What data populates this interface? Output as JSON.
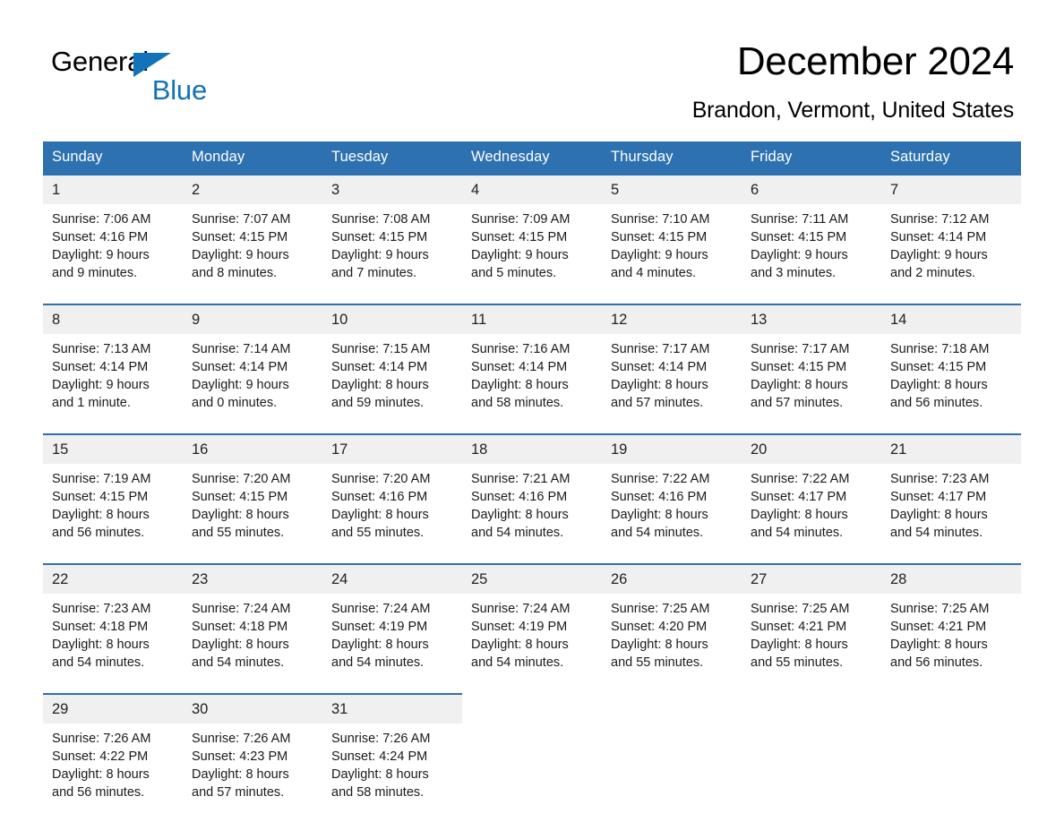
{
  "brand": {
    "word_general": "General",
    "word_blue": "Blue",
    "triangle_color": "#1272BA"
  },
  "header": {
    "month_title": "December 2024",
    "location": "Brandon, Vermont, United States"
  },
  "theme": {
    "header_blue": "#2E71B0",
    "date_band_gray": "#F0F0F0",
    "text_color": "#1a1a1a"
  },
  "weekday_headers": [
    "Sunday",
    "Monday",
    "Tuesday",
    "Wednesday",
    "Thursday",
    "Friday",
    "Saturday"
  ],
  "weeks": [
    [
      {
        "day": "1",
        "sunrise": "Sunrise: 7:06 AM",
        "sunset": "Sunset: 4:16 PM",
        "daylight_line1": "Daylight: 9 hours",
        "daylight_line2": "and 9 minutes."
      },
      {
        "day": "2",
        "sunrise": "Sunrise: 7:07 AM",
        "sunset": "Sunset: 4:15 PM",
        "daylight_line1": "Daylight: 9 hours",
        "daylight_line2": "and 8 minutes."
      },
      {
        "day": "3",
        "sunrise": "Sunrise: 7:08 AM",
        "sunset": "Sunset: 4:15 PM",
        "daylight_line1": "Daylight: 9 hours",
        "daylight_line2": "and 7 minutes."
      },
      {
        "day": "4",
        "sunrise": "Sunrise: 7:09 AM",
        "sunset": "Sunset: 4:15 PM",
        "daylight_line1": "Daylight: 9 hours",
        "daylight_line2": "and 5 minutes."
      },
      {
        "day": "5",
        "sunrise": "Sunrise: 7:10 AM",
        "sunset": "Sunset: 4:15 PM",
        "daylight_line1": "Daylight: 9 hours",
        "daylight_line2": "and 4 minutes."
      },
      {
        "day": "6",
        "sunrise": "Sunrise: 7:11 AM",
        "sunset": "Sunset: 4:15 PM",
        "daylight_line1": "Daylight: 9 hours",
        "daylight_line2": "and 3 minutes."
      },
      {
        "day": "7",
        "sunrise": "Sunrise: 7:12 AM",
        "sunset": "Sunset: 4:14 PM",
        "daylight_line1": "Daylight: 9 hours",
        "daylight_line2": "and 2 minutes."
      }
    ],
    [
      {
        "day": "8",
        "sunrise": "Sunrise: 7:13 AM",
        "sunset": "Sunset: 4:14 PM",
        "daylight_line1": "Daylight: 9 hours",
        "daylight_line2": "and 1 minute."
      },
      {
        "day": "9",
        "sunrise": "Sunrise: 7:14 AM",
        "sunset": "Sunset: 4:14 PM",
        "daylight_line1": "Daylight: 9 hours",
        "daylight_line2": "and 0 minutes."
      },
      {
        "day": "10",
        "sunrise": "Sunrise: 7:15 AM",
        "sunset": "Sunset: 4:14 PM",
        "daylight_line1": "Daylight: 8 hours",
        "daylight_line2": "and 59 minutes."
      },
      {
        "day": "11",
        "sunrise": "Sunrise: 7:16 AM",
        "sunset": "Sunset: 4:14 PM",
        "daylight_line1": "Daylight: 8 hours",
        "daylight_line2": "and 58 minutes."
      },
      {
        "day": "12",
        "sunrise": "Sunrise: 7:17 AM",
        "sunset": "Sunset: 4:14 PM",
        "daylight_line1": "Daylight: 8 hours",
        "daylight_line2": "and 57 minutes."
      },
      {
        "day": "13",
        "sunrise": "Sunrise: 7:17 AM",
        "sunset": "Sunset: 4:15 PM",
        "daylight_line1": "Daylight: 8 hours",
        "daylight_line2": "and 57 minutes."
      },
      {
        "day": "14",
        "sunrise": "Sunrise: 7:18 AM",
        "sunset": "Sunset: 4:15 PM",
        "daylight_line1": "Daylight: 8 hours",
        "daylight_line2": "and 56 minutes."
      }
    ],
    [
      {
        "day": "15",
        "sunrise": "Sunrise: 7:19 AM",
        "sunset": "Sunset: 4:15 PM",
        "daylight_line1": "Daylight: 8 hours",
        "daylight_line2": "and 56 minutes."
      },
      {
        "day": "16",
        "sunrise": "Sunrise: 7:20 AM",
        "sunset": "Sunset: 4:15 PM",
        "daylight_line1": "Daylight: 8 hours",
        "daylight_line2": "and 55 minutes."
      },
      {
        "day": "17",
        "sunrise": "Sunrise: 7:20 AM",
        "sunset": "Sunset: 4:16 PM",
        "daylight_line1": "Daylight: 8 hours",
        "daylight_line2": "and 55 minutes."
      },
      {
        "day": "18",
        "sunrise": "Sunrise: 7:21 AM",
        "sunset": "Sunset: 4:16 PM",
        "daylight_line1": "Daylight: 8 hours",
        "daylight_line2": "and 54 minutes."
      },
      {
        "day": "19",
        "sunrise": "Sunrise: 7:22 AM",
        "sunset": "Sunset: 4:16 PM",
        "daylight_line1": "Daylight: 8 hours",
        "daylight_line2": "and 54 minutes."
      },
      {
        "day": "20",
        "sunrise": "Sunrise: 7:22 AM",
        "sunset": "Sunset: 4:17 PM",
        "daylight_line1": "Daylight: 8 hours",
        "daylight_line2": "and 54 minutes."
      },
      {
        "day": "21",
        "sunrise": "Sunrise: 7:23 AM",
        "sunset": "Sunset: 4:17 PM",
        "daylight_line1": "Daylight: 8 hours",
        "daylight_line2": "and 54 minutes."
      }
    ],
    [
      {
        "day": "22",
        "sunrise": "Sunrise: 7:23 AM",
        "sunset": "Sunset: 4:18 PM",
        "daylight_line1": "Daylight: 8 hours",
        "daylight_line2": "and 54 minutes."
      },
      {
        "day": "23",
        "sunrise": "Sunrise: 7:24 AM",
        "sunset": "Sunset: 4:18 PM",
        "daylight_line1": "Daylight: 8 hours",
        "daylight_line2": "and 54 minutes."
      },
      {
        "day": "24",
        "sunrise": "Sunrise: 7:24 AM",
        "sunset": "Sunset: 4:19 PM",
        "daylight_line1": "Daylight: 8 hours",
        "daylight_line2": "and 54 minutes."
      },
      {
        "day": "25",
        "sunrise": "Sunrise: 7:24 AM",
        "sunset": "Sunset: 4:19 PM",
        "daylight_line1": "Daylight: 8 hours",
        "daylight_line2": "and 54 minutes."
      },
      {
        "day": "26",
        "sunrise": "Sunrise: 7:25 AM",
        "sunset": "Sunset: 4:20 PM",
        "daylight_line1": "Daylight: 8 hours",
        "daylight_line2": "and 55 minutes."
      },
      {
        "day": "27",
        "sunrise": "Sunrise: 7:25 AM",
        "sunset": "Sunset: 4:21 PM",
        "daylight_line1": "Daylight: 8 hours",
        "daylight_line2": "and 55 minutes."
      },
      {
        "day": "28",
        "sunrise": "Sunrise: 7:25 AM",
        "sunset": "Sunset: 4:21 PM",
        "daylight_line1": "Daylight: 8 hours",
        "daylight_line2": "and 56 minutes."
      }
    ],
    [
      {
        "day": "29",
        "sunrise": "Sunrise: 7:26 AM",
        "sunset": "Sunset: 4:22 PM",
        "daylight_line1": "Daylight: 8 hours",
        "daylight_line2": "and 56 minutes."
      },
      {
        "day": "30",
        "sunrise": "Sunrise: 7:26 AM",
        "sunset": "Sunset: 4:23 PM",
        "daylight_line1": "Daylight: 8 hours",
        "daylight_line2": "and 57 minutes."
      },
      {
        "day": "31",
        "sunrise": "Sunrise: 7:26 AM",
        "sunset": "Sunset: 4:24 PM",
        "daylight_line1": "Daylight: 8 hours",
        "daylight_line2": "and 58 minutes."
      },
      {
        "day": "",
        "sunrise": "",
        "sunset": "",
        "daylight_line1": "",
        "daylight_line2": ""
      },
      {
        "day": "",
        "sunrise": "",
        "sunset": "",
        "daylight_line1": "",
        "daylight_line2": ""
      },
      {
        "day": "",
        "sunrise": "",
        "sunset": "",
        "daylight_line1": "",
        "daylight_line2": ""
      },
      {
        "day": "",
        "sunrise": "",
        "sunset": "",
        "daylight_line1": "",
        "daylight_line2": ""
      }
    ]
  ]
}
